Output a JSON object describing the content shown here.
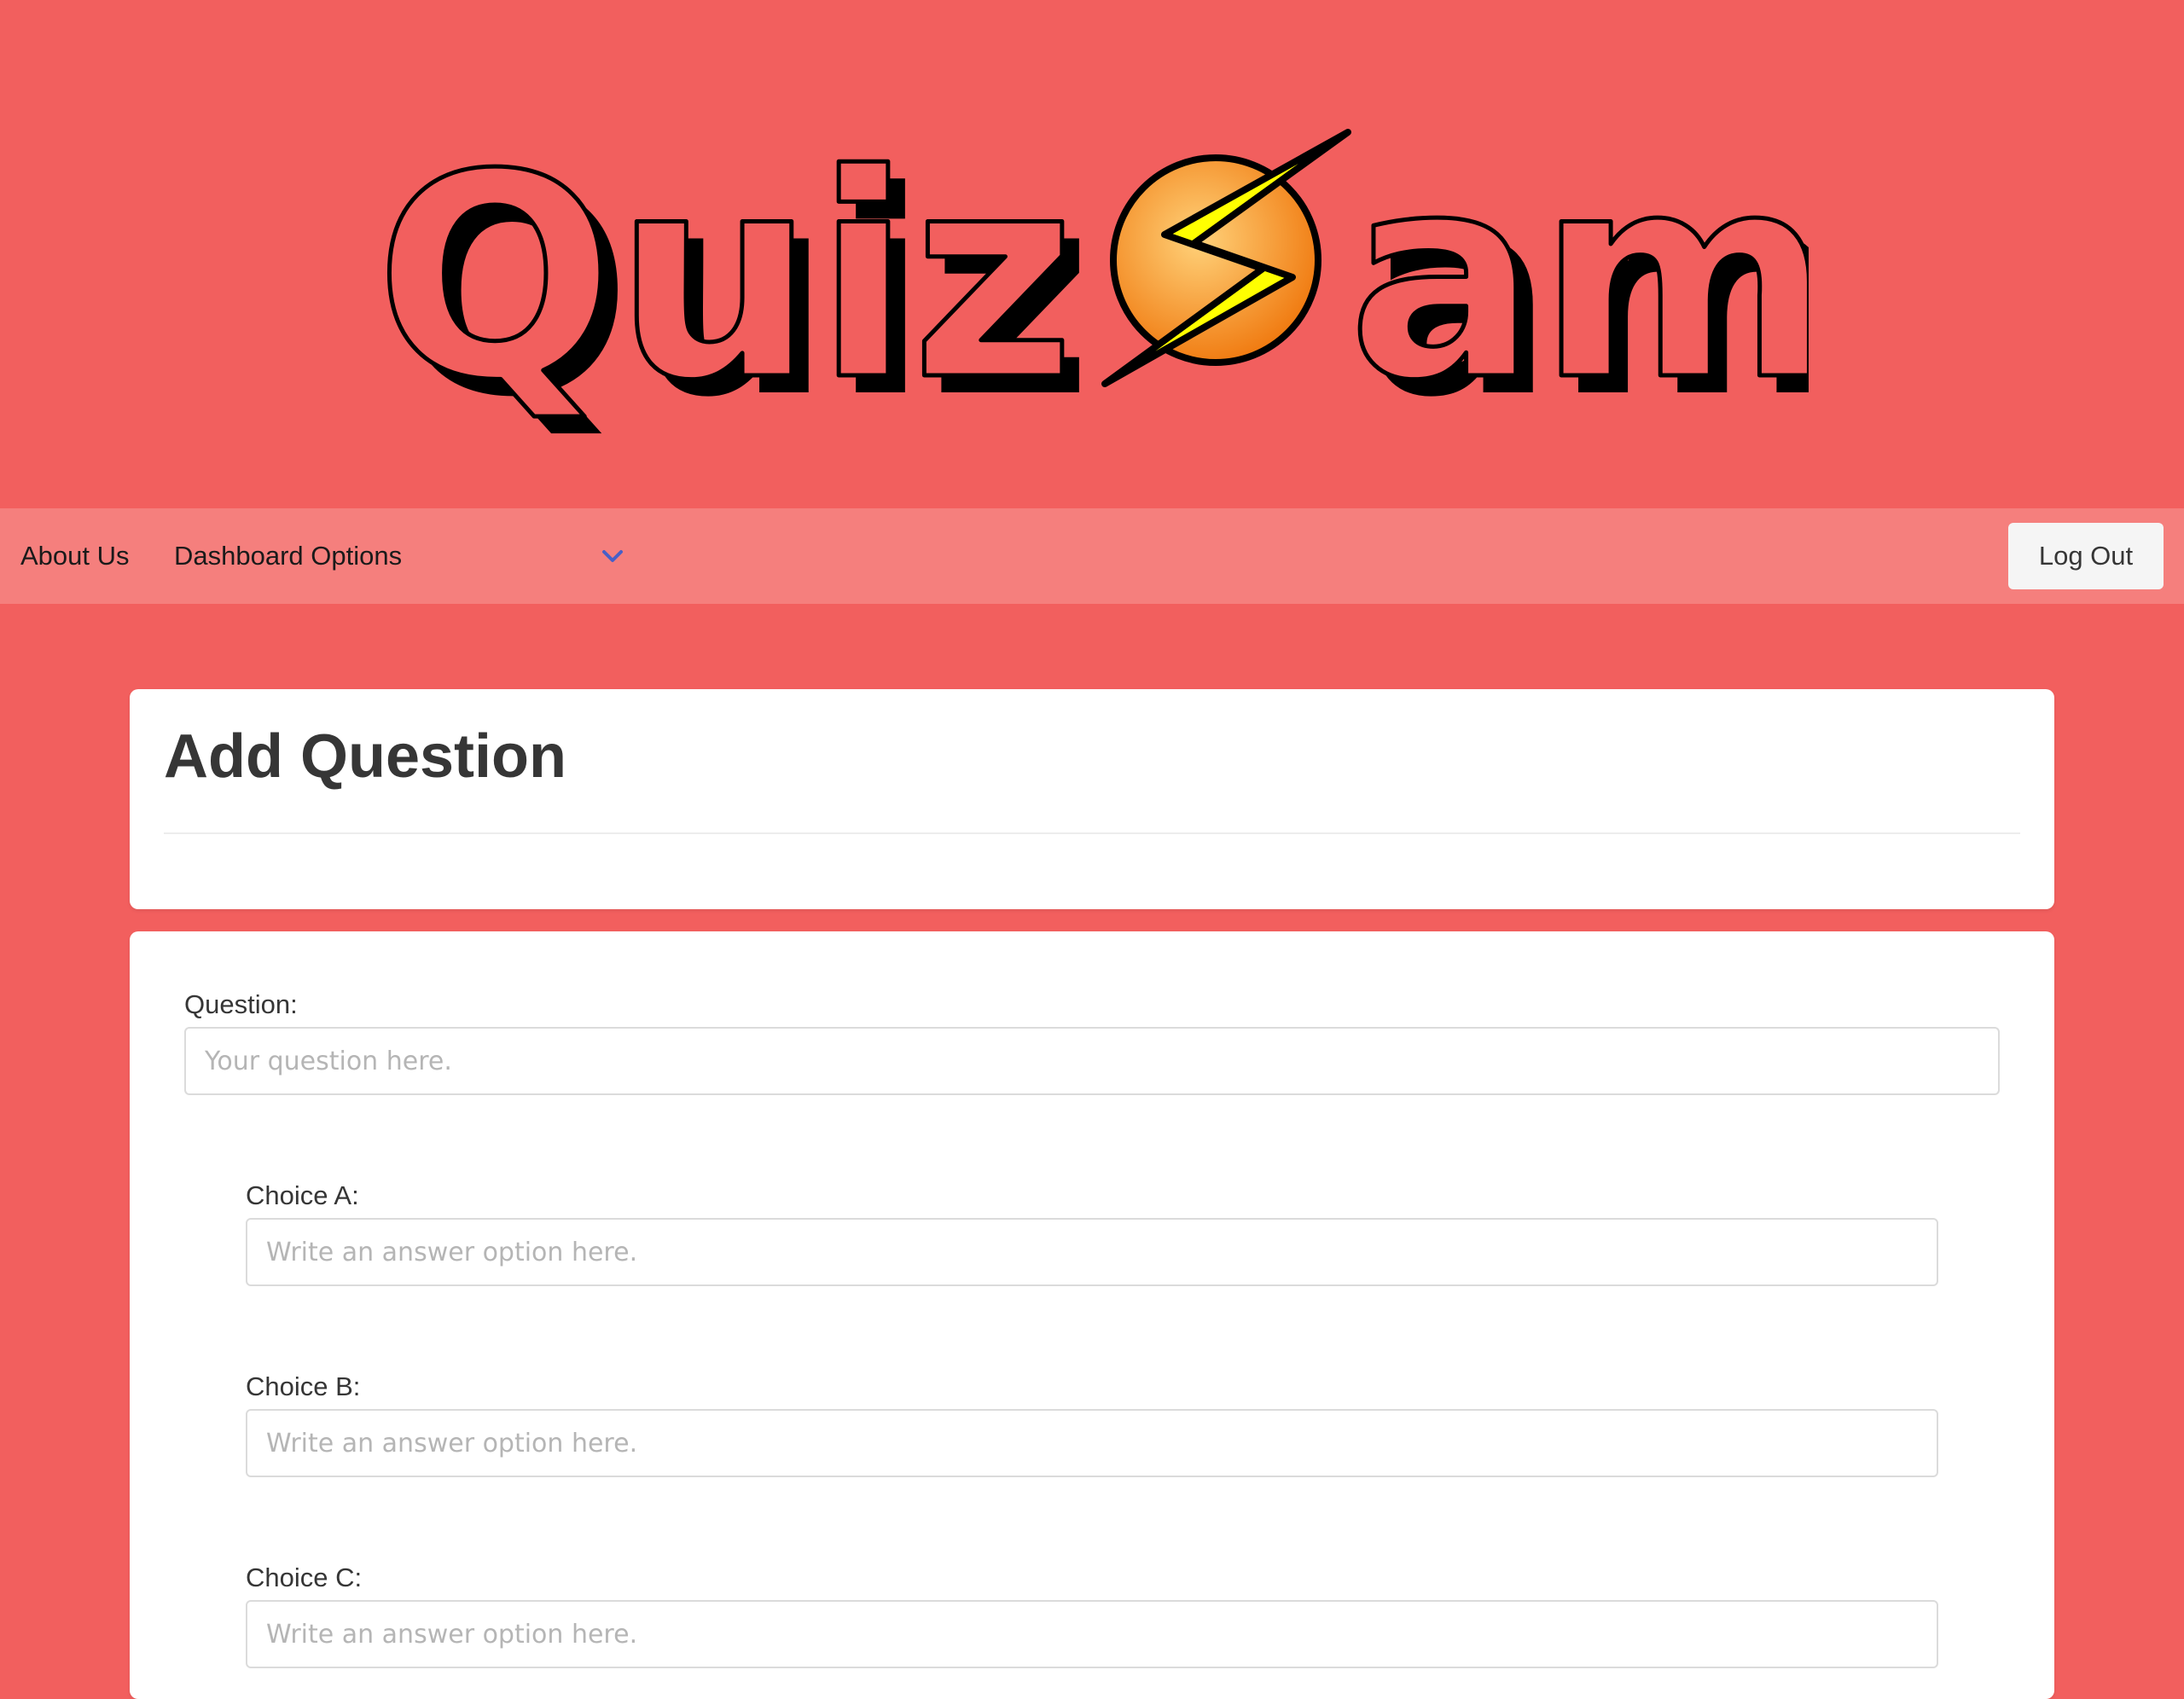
{
  "logo": {
    "text_left": "Quiz",
    "text_right": "am",
    "bolt_colors": {
      "circle_inner": "#ffd27a",
      "circle_outer": "#f07a10",
      "bolt": "#ffff00"
    }
  },
  "nav": {
    "about_label": "About Us",
    "dashboard_label": "Dashboard Options",
    "logout_label": "Log Out"
  },
  "page": {
    "title": "Add Question"
  },
  "form": {
    "question": {
      "label": "Question:",
      "placeholder": "Your question here.",
      "value": ""
    },
    "choices": [
      {
        "label": "Choice A:",
        "placeholder": "Write an answer option here.",
        "value": ""
      },
      {
        "label": "Choice B:",
        "placeholder": "Write an answer option here.",
        "value": ""
      },
      {
        "label": "Choice C:",
        "placeholder": "Write an answer option here.",
        "value": ""
      }
    ]
  },
  "colors": {
    "background": "#f25f5e",
    "navbar": "#f57f7d",
    "card": "#ffffff",
    "text": "#363636",
    "chevron": "#485fc7"
  }
}
